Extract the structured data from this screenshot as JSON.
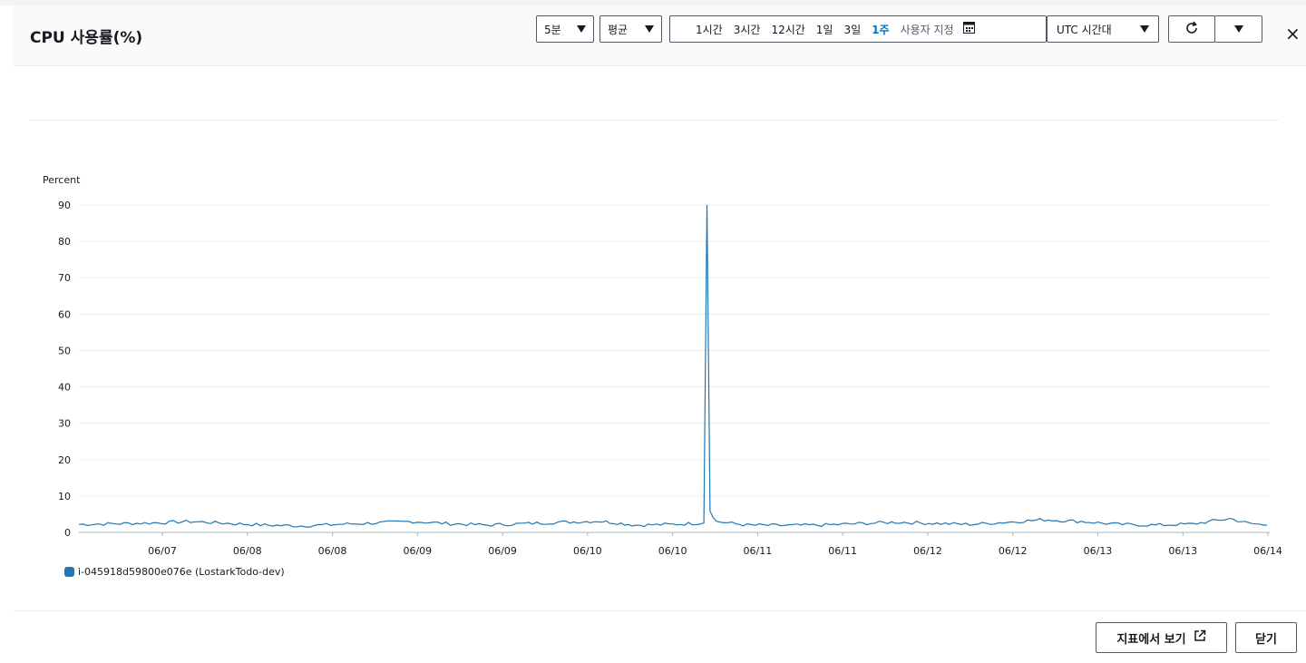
{
  "header": {
    "title": "CPU 사용률(%)",
    "period": "5분",
    "statistic": "평균",
    "ranges": [
      "1시간",
      "3시간",
      "12시간",
      "1일",
      "3일",
      "1주"
    ],
    "active_range": "1주",
    "custom_range": "사용자 지정",
    "timezone": "UTC 시간대",
    "close": "×"
  },
  "footer": {
    "view_in_metrics": "지표에서 보기",
    "close_button": "닫기"
  },
  "colors": {
    "series": "#1f77b4",
    "accent": "#0073bb"
  },
  "chart_data": {
    "type": "line",
    "ylabel": "Percent",
    "ylim": [
      0,
      90
    ],
    "yticks": [
      "0",
      "10",
      "20",
      "30",
      "40",
      "50",
      "60",
      "70",
      "80",
      "90"
    ],
    "xticks": [
      "06/07",
      "06/08",
      "06/08",
      "06/09",
      "06/09",
      "06/10",
      "06/10",
      "06/11",
      "06/11",
      "06/12",
      "06/12",
      "06/13",
      "06/13",
      "06/14"
    ],
    "grid": true,
    "legend_position": "bottom-left",
    "series": [
      {
        "name": "i-045918d59800e076e (LostarkTodo-dev)",
        "x": [
          "06/06 15:00",
          "06/06 21:00",
          "06/07 03:00",
          "06/07 09:00",
          "06/07 15:00",
          "06/07 21:00",
          "06/08 03:00",
          "06/08 09:00",
          "06/08 15:00",
          "06/08 21:00",
          "06/09 03:00",
          "06/09 09:00",
          "06/09 15:00",
          "06/09 21:00",
          "06/10 03:00",
          "06/10 06:00",
          "06/10 09:00",
          "06/10 15:00",
          "06/10 20:00",
          "06/10 20:30",
          "06/10 21:00",
          "06/10 22:00",
          "06/11 03:00",
          "06/11 09:00",
          "06/11 15:00",
          "06/11 21:00",
          "06/12 03:00",
          "06/12 09:00",
          "06/12 15:00",
          "06/12 21:00",
          "06/13 03:00",
          "06/13 09:00",
          "06/13 15:00",
          "06/13 21:00",
          "06/14 03:00",
          "06/14 09:00",
          "06/14 12:00",
          "06/14 15:00"
        ],
        "y": [
          2.2,
          2.4,
          2.6,
          3.0,
          2.5,
          2.0,
          1.8,
          2.2,
          2.6,
          3.0,
          2.4,
          2.0,
          2.4,
          2.8,
          3.1,
          2.6,
          2.0,
          2.2,
          2.6,
          90,
          6.0,
          3.0,
          2.0,
          1.9,
          2.0,
          2.4,
          2.8,
          2.5,
          2.2,
          2.8,
          3.5,
          3.0,
          2.2,
          2.0,
          2.3,
          3.8,
          2.5,
          2.0
        ]
      }
    ]
  }
}
